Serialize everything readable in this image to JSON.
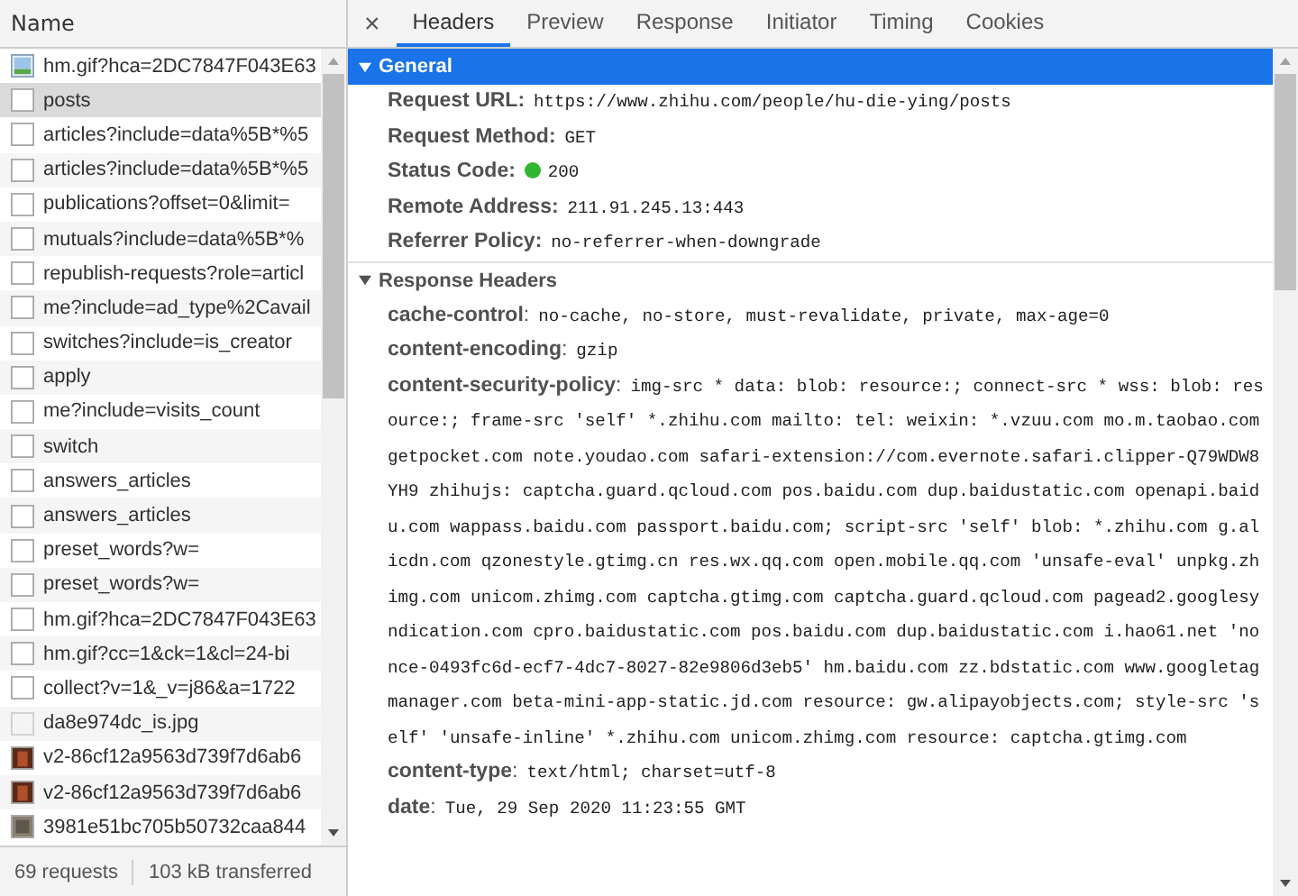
{
  "requests_panel": {
    "column_header": "Name",
    "rows": [
      {
        "name": "hm.gif?hca=2DC7847F043E63",
        "kind": "image",
        "selected": false
      },
      {
        "name": "posts",
        "kind": "document",
        "selected": true
      },
      {
        "name": "articles?include=data%5B*%5",
        "kind": "document",
        "selected": false
      },
      {
        "name": "articles?include=data%5B*%5",
        "kind": "document",
        "selected": false
      },
      {
        "name": "publications?offset=0&limit=",
        "kind": "document",
        "selected": false
      },
      {
        "name": "mutuals?include=data%5B*%",
        "kind": "document",
        "selected": false
      },
      {
        "name": "republish-requests?role=articl",
        "kind": "document",
        "selected": false
      },
      {
        "name": "me?include=ad_type%2Cavail",
        "kind": "document",
        "selected": false
      },
      {
        "name": "switches?include=is_creator",
        "kind": "document",
        "selected": false
      },
      {
        "name": "apply",
        "kind": "document",
        "selected": false
      },
      {
        "name": "me?include=visits_count",
        "kind": "document",
        "selected": false
      },
      {
        "name": "switch",
        "kind": "document",
        "selected": false
      },
      {
        "name": "answers_articles",
        "kind": "document",
        "selected": false
      },
      {
        "name": "answers_articles",
        "kind": "document",
        "selected": false
      },
      {
        "name": "preset_words?w=",
        "kind": "document",
        "selected": false
      },
      {
        "name": "preset_words?w=",
        "kind": "document",
        "selected": false
      },
      {
        "name": "hm.gif?hca=2DC7847F043E63",
        "kind": "document",
        "selected": false
      },
      {
        "name": "hm.gif?cc=1&ck=1&cl=24-bi",
        "kind": "document",
        "selected": false
      },
      {
        "name": "collect?v=1&_v=j86&a=1722",
        "kind": "document",
        "selected": false
      },
      {
        "name": "da8e974dc_is.jpg",
        "kind": "blank-image",
        "selected": false
      },
      {
        "name": "v2-86cf12a9563d739f7d6ab6",
        "kind": "thumbnail",
        "selected": false
      },
      {
        "name": "v2-86cf12a9563d739f7d6ab6",
        "kind": "thumbnail",
        "selected": false
      },
      {
        "name": "3981e51bc705b50732caa844",
        "kind": "gray-thumbnail",
        "selected": false
      }
    ],
    "status_bar": [
      "69 requests",
      "103 kB transferred"
    ]
  },
  "details_panel": {
    "close": "×",
    "tabs": [
      {
        "label": "Headers",
        "selected": true
      },
      {
        "label": "Preview",
        "selected": false
      },
      {
        "label": "Response",
        "selected": false
      },
      {
        "label": "Initiator",
        "selected": false
      },
      {
        "label": "Timing",
        "selected": false
      },
      {
        "label": "Cookies",
        "selected": false
      }
    ],
    "sections": [
      {
        "title": "General",
        "selected": true,
        "expanded": true,
        "kind": "general",
        "rows": [
          {
            "key": "Request URL:",
            "value": "https://www.zhihu.com/people/hu-die-ying/posts"
          },
          {
            "key": "Request Method:",
            "value": "GET"
          },
          {
            "key": "Status Code:",
            "value": "200",
            "color": "#2fb82f"
          },
          {
            "key": "Remote Address:",
            "value": "211.91.245.13:443"
          },
          {
            "key": "Referrer Policy:",
            "value": "no-referrer-when-downgrade"
          }
        ]
      },
      {
        "title": "Response Headers",
        "selected": false,
        "expanded": true,
        "kind": "headers",
        "rows": [
          {
            "key": "**cache-control**:",
            "value": "no-cache, no-store, must-revalidate, private, max-age=0"
          },
          {
            "key": "**content-encoding**:",
            "value": "gzip"
          },
          {
            "key": "**content-security-policy**:",
            "value": "img-src * data: blob: resource:; connect-src * wss: blob: resource:; frame-src 'self' *.zhihu.com mailto: tel: weixin: *.vzuu.com mo.m.taobao.com getpocket.com note.youdao.com safari-extension://com.evernote.safari.clipper-Q79WDW8YH9 zhihujs: captcha.guard.qcloud.com pos.baidu.com dup.baidustatic.com openapi.baidu.com wappass.baidu.com passport.baidu.com; script-src 'self' blob: *.zhihu.com g.alicdn.com qzonestyle.gtimg.cn res.wx.qq.com open.mobile.qq.com 'unsafe-eval' unpkg.zhimg.com unicom.zhimg.com captcha.gtimg.com captcha.guard.qcloud.com pagead2.googlesyndication.com cpro.baidustatic.com pos.baidu.com dup.baidustatic.com i.hao61.net 'nonce-0493fc6d-ecf7-4dc7-8027-82e9806d3eb5' hm.baidu.com zz.bdstatic.com www.googletagmanager.com beta-mini-app-static.jd.com resource: gw.alipayobjects.com; style-src 'self' 'unsafe-inline' *.zhihu.com unicom.zhimg.com resource: captcha.gtimg.com"
          },
          {
            "key": "**content-type**:",
            "value": "text/html; charset=utf-8"
          },
          {
            "key": "**date**:",
            "value": "Tue, 29 Sep 2020 11:23:55 GMT"
          }
        ]
      }
    ]
  }
}
